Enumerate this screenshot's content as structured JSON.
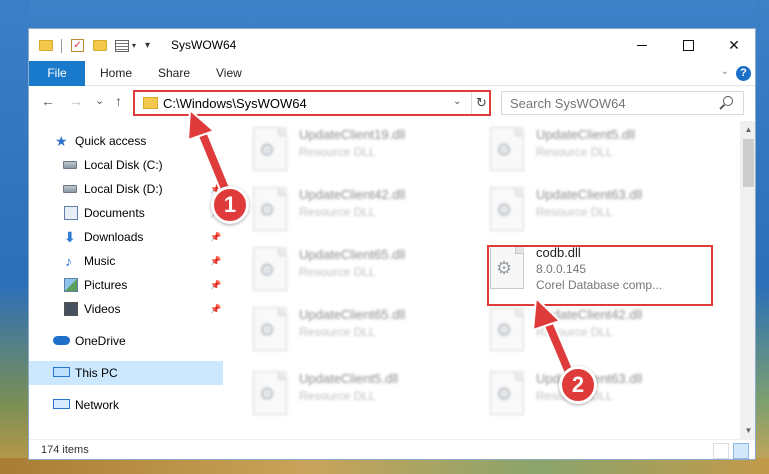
{
  "window": {
    "title": "SysWOW64",
    "controls": {
      "minimize": "",
      "maximize": "",
      "close": "✕"
    }
  },
  "ribbon": {
    "tabs": [
      "File",
      "Home",
      "Share",
      "View"
    ],
    "help": "?"
  },
  "address_bar": {
    "path": "C:\\Windows\\SysWOW64",
    "refresh": "↻"
  },
  "search": {
    "placeholder": "Search SysWOW64"
  },
  "navigation": {
    "back": "←",
    "forward": "→",
    "recent": "⌄",
    "up": "↑"
  },
  "nav_pane": {
    "items": [
      {
        "label": "Quick access",
        "icon": "quick-access-star-icon"
      },
      {
        "label": "Local Disk (C:)",
        "icon": "drive-icon"
      },
      {
        "label": "Local Disk (D:)",
        "icon": "drive-icon",
        "pinned": true
      },
      {
        "label": "Documents",
        "icon": "documents-icon",
        "pinned": true
      },
      {
        "label": "Downloads",
        "icon": "downloads-icon",
        "pinned": true
      },
      {
        "label": "Music",
        "icon": "music-icon",
        "pinned": true
      },
      {
        "label": "Pictures",
        "icon": "pictures-icon",
        "pinned": true
      },
      {
        "label": "Videos",
        "icon": "videos-icon",
        "pinned": true
      },
      {
        "label": "OneDrive",
        "icon": "onedrive-icon"
      },
      {
        "label": "This PC",
        "icon": "this-pc-icon",
        "selected": true
      },
      {
        "label": "Network",
        "icon": "network-icon"
      }
    ],
    "pin_glyph": "📌"
  },
  "files": [
    {
      "name": "UpdateClient19.dll",
      "type": "Resource DLL"
    },
    {
      "name": "UpdateClient5.dll",
      "type": "Resource DLL"
    },
    {
      "name": "UpdateClient42.dll",
      "type": "Resource DLL"
    },
    {
      "name": "UpdateClient63.dll",
      "type": "Resource DLL"
    },
    {
      "name": "UpdateClient65.dll",
      "type": "Resource DLL"
    },
    {
      "name": "codb.dll",
      "version": "8.0.0.145",
      "type": "Corel Database comp..."
    },
    {
      "name": "UpdateClient65.dll",
      "type": "Resource DLL"
    },
    {
      "name": "UpdateClient42.dll",
      "type": "Resource DLL"
    },
    {
      "name": "UpdateClient5.dll",
      "type": "Resource DLL"
    },
    {
      "name": "UpdateClient63.dll",
      "type": "Resource DLL"
    }
  ],
  "status_bar": {
    "item_count": "174 items"
  },
  "annotations": {
    "step1": "1",
    "step2": "2"
  },
  "colors": {
    "accent": "#1979ca",
    "highlight": "#e03b3b",
    "selected": "#cce8ff"
  }
}
